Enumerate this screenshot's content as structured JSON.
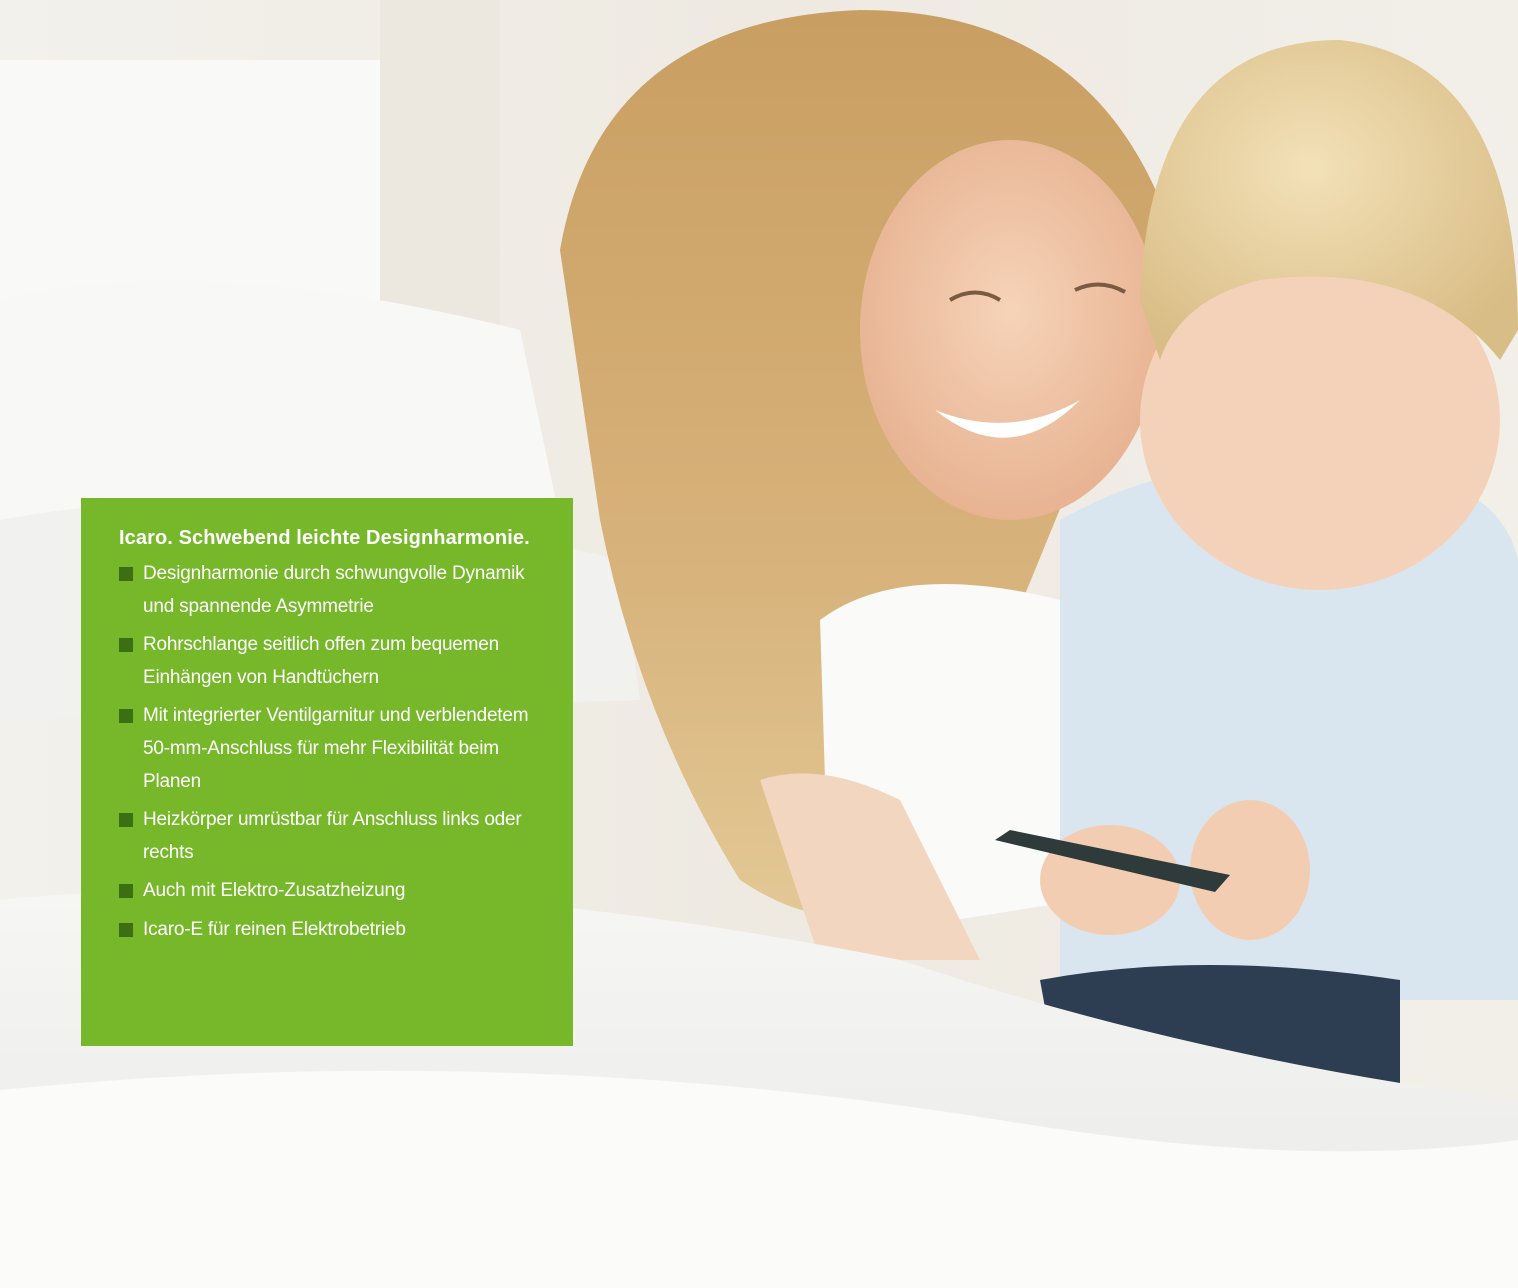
{
  "infobox": {
    "title": "Icaro. Schwebend leichte Designharmonie.",
    "items": [
      "Designharmonie durch schwungvolle Dynamik und spannende Asymmetrie",
      "Rohrschlange seitlich offen zum bequemen Einhängen von Handtüchern",
      "Mit integrierter Ventilgarnitur und verblendetem 50-mm-Anschluss für mehr Flexibilität beim Planen",
      "Heizkörper umrüstbar für Anschluss links oder rechts",
      "Auch mit Elektro-Zusatzheizung",
      "Icaro-E für reinen Elektrobetrieb"
    ],
    "bullet_icon": "square-bullet-icon"
  },
  "colors": {
    "box_green": "#76b82a",
    "bullet_green": "#3c6e14",
    "text": "#ffffff"
  }
}
